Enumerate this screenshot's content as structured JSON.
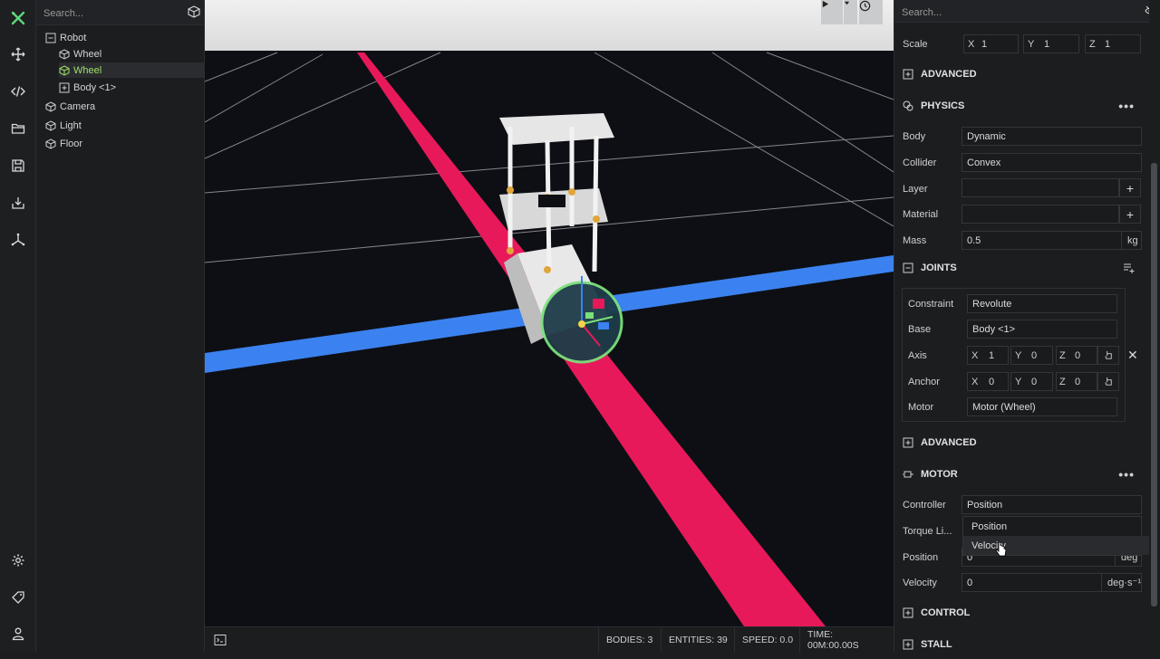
{
  "toolbar": {
    "icons": [
      "app-logo-icon",
      "move-icon",
      "code-icon",
      "folder-icon",
      "save-icon",
      "download-icon",
      "axes-icon",
      "settings-icon",
      "tag-icon",
      "user-icon"
    ]
  },
  "hierarchy": {
    "search_placeholder": "Search...",
    "items": [
      {
        "label": "Robot",
        "icon": "expand-box-icon"
      },
      {
        "label": "Wheel",
        "icon": "cube-icon"
      },
      {
        "label": "Wheel",
        "icon": "cube-icon"
      },
      {
        "label": "Body <1>",
        "icon": "expand-box-icon"
      },
      {
        "label": "Camera",
        "icon": "cube-icon"
      },
      {
        "label": "Light",
        "icon": "cube-icon"
      },
      {
        "label": "Floor",
        "icon": "cube-icon"
      }
    ]
  },
  "status": {
    "bodies": "BODIES: 3",
    "entities": "ENTITIES: 39",
    "speed": "SPEED: 0.0",
    "time": "TIME: 00M:00.00S"
  },
  "inspector": {
    "search_placeholder": "Search...",
    "scale": {
      "label": "Scale",
      "x_label": "X",
      "x": "1",
      "y_label": "Y",
      "y": "1",
      "z_label": "Z",
      "z": "1"
    },
    "advanced1": "ADVANCED",
    "physics": {
      "title": "PHYSICS",
      "body_label": "Body",
      "body": "Dynamic",
      "collider_label": "Collider",
      "collider": "Convex",
      "layer_label": "Layer",
      "layer": "",
      "material_label": "Material",
      "material": "",
      "mass_label": "Mass",
      "mass": "0.5",
      "mass_unit": "kg"
    },
    "joints": {
      "title": "JOINTS",
      "constraint_label": "Constraint",
      "constraint": "Revolute",
      "base_label": "Base",
      "base": "Body <1>",
      "axis_label": "Axis",
      "axis_x": "1",
      "axis_y": "0",
      "axis_z": "0",
      "anchor_label": "Anchor",
      "anchor_x": "0",
      "anchor_y": "0",
      "anchor_z": "0",
      "motor_label": "Motor",
      "motor": "Motor (Wheel)",
      "x_label": "X",
      "y_label": "Y",
      "z_label": "Z"
    },
    "advanced2": "ADVANCED",
    "motor": {
      "title": "MOTOR",
      "controller_label": "Controller",
      "controller": "Position",
      "torque_label": "Torque Li...",
      "position_label": "Position",
      "position": "0",
      "position_unit": "deg",
      "velocity_label": "Velocity",
      "velocity": "0",
      "velocity_unit": "deg·s⁻¹",
      "options": [
        "Position",
        "Velocity"
      ]
    },
    "control": "CONTROL",
    "stall": "STALL"
  },
  "colors": {
    "accent_green": "#9fe06a",
    "x_axis_red": "#e8195a",
    "z_axis_blue": "#3b82f0",
    "gizmo_green": "#7be07b"
  }
}
